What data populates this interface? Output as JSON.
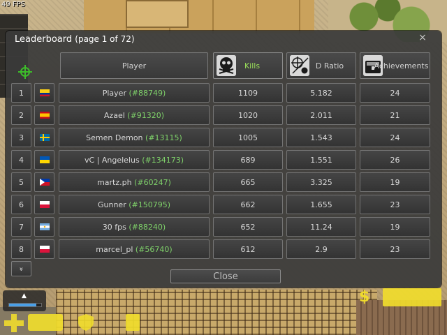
{
  "hud": {
    "fps": "49 FPS"
  },
  "dialog": {
    "title": "Leaderboard",
    "page_info": "(page 1 of 72)",
    "close_x": "×",
    "close_button": "Close",
    "more_button": "»"
  },
  "columns": {
    "player": "Player",
    "kills": "Kills",
    "kd_ratio": "D Ratio",
    "achievements": "Achievements"
  },
  "rows": [
    {
      "rank": "1",
      "flag": "colombia",
      "name": "Player",
      "id": "(#88749)",
      "kills": "1109",
      "ratio": "5.182",
      "achievements": "24"
    },
    {
      "rank": "2",
      "flag": "spain",
      "name": "Azael",
      "id": "(#91320)",
      "kills": "1020",
      "ratio": "2.011",
      "achievements": "21"
    },
    {
      "rank": "3",
      "flag": "sweden",
      "name": "Semen Demon",
      "id": "(#13115)",
      "kills": "1005",
      "ratio": "1.543",
      "achievements": "24"
    },
    {
      "rank": "4",
      "flag": "ukraine",
      "name": "vC | Angelelus",
      "id": "(#134173)",
      "kills": "689",
      "ratio": "1.551",
      "achievements": "26"
    },
    {
      "rank": "5",
      "flag": "philippines",
      "name": "martz.ph",
      "id": "(#60247)",
      "kills": "665",
      "ratio": "3.325",
      "achievements": "19"
    },
    {
      "rank": "6",
      "flag": "poland",
      "name": "Gunner",
      "id": "(#150795)",
      "kills": "662",
      "ratio": "1.655",
      "achievements": "23"
    },
    {
      "rank": "7",
      "flag": "argentina",
      "name": "30 fps",
      "id": "(#88240)",
      "kills": "652",
      "ratio": "11.24",
      "achievements": "19"
    },
    {
      "rank": "8",
      "flag": "poland",
      "name": "marcel_pl",
      "id": "(#56740)",
      "kills": "612",
      "ratio": "2.9",
      "achievements": "23"
    }
  ],
  "colors": {
    "accent_green": "#7fd26a",
    "kills_header": "#9be05a",
    "hud_yellow": "#f0dc2c"
  },
  "icons": {
    "crosshair": "crosshair-icon",
    "kills": "skull-icon",
    "kd_ratio": "skull-crosshair-icon",
    "achievements": "treasure-chest-icon",
    "money": "dollar-icon"
  },
  "bottom_hud": {
    "money_symbol": "$"
  }
}
